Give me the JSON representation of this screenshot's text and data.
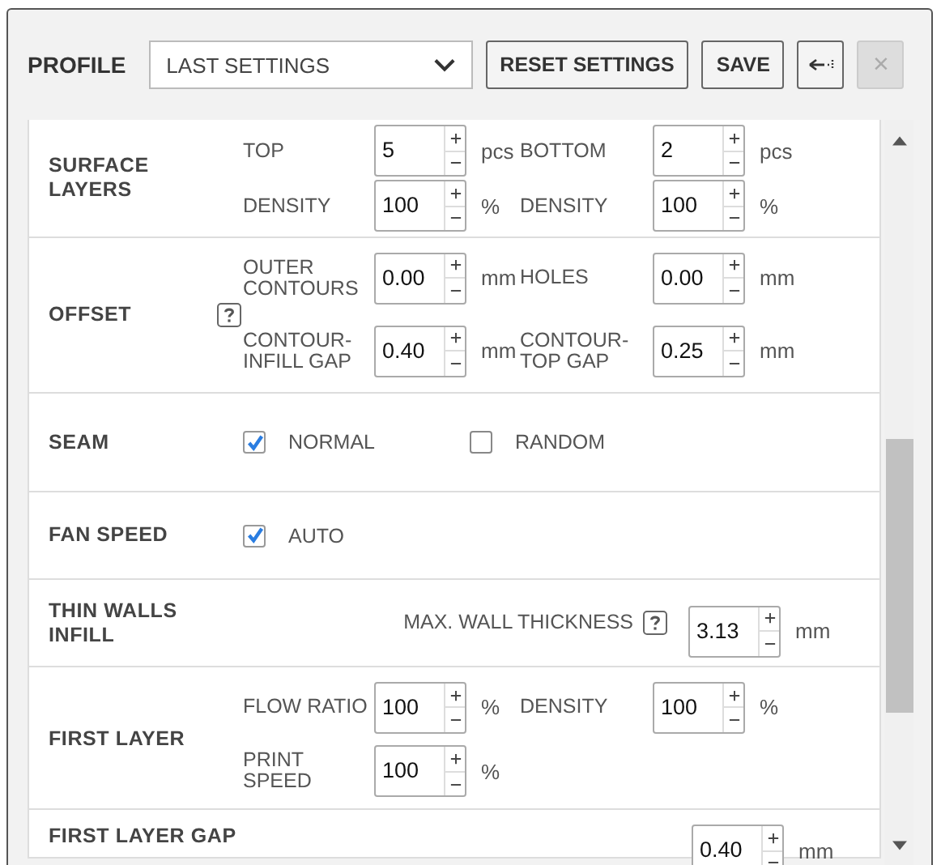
{
  "header": {
    "label": "PROFILE",
    "profile_select": {
      "value": "LAST SETTINGS"
    },
    "buttons": [
      {
        "kind": "text",
        "label": "RESET SETTINGS",
        "disabled": false
      },
      {
        "kind": "text",
        "label": "SAVE",
        "disabled": false
      },
      {
        "kind": "back_icon",
        "disabled": false
      },
      {
        "kind": "close",
        "label": "×",
        "disabled": true
      }
    ]
  },
  "sections": [
    {
      "kind": "fields",
      "title": "SURFACE LAYERS",
      "rows": [
        [
          {
            "label": "TOP",
            "value": "5",
            "unit": "pcs"
          },
          {
            "label": "BOTTOM",
            "value": "2",
            "unit": "pcs"
          }
        ],
        [
          {
            "label": "DENSITY",
            "value": "100",
            "unit": "%"
          },
          {
            "label": "DENSITY",
            "value": "100",
            "unit": "%"
          }
        ]
      ]
    },
    {
      "kind": "fields",
      "title": "OFFSET",
      "help": true,
      "rows": [
        [
          {
            "label": "OUTER CONTOURS",
            "value": "0.00",
            "unit": "mm"
          },
          {
            "label": "HOLES",
            "value": "0.00",
            "unit": "mm"
          }
        ],
        [
          {
            "label": "CONTOUR-INFILL GAP",
            "value": "0.40",
            "unit": "mm"
          },
          {
            "label": "CONTOUR-TOP GAP",
            "value": "0.25",
            "unit": "mm"
          }
        ]
      ]
    },
    {
      "kind": "checks",
      "title": "SEAM",
      "items": [
        {
          "label": "NORMAL",
          "checked": true
        },
        {
          "label": "RANDOM",
          "checked": false
        }
      ]
    },
    {
      "kind": "checks",
      "title": "FAN SPEED",
      "items": [
        {
          "label": "AUTO",
          "checked": true
        }
      ]
    },
    {
      "kind": "wide_field",
      "title": "THIN WALLS INFILL",
      "field": {
        "label": "MAX. WALL THICKNESS",
        "help": true,
        "value": "3.13",
        "unit": "mm"
      }
    },
    {
      "kind": "fields",
      "title": "FIRST LAYER",
      "rows": [
        [
          {
            "label": "FLOW RATIO",
            "value": "100",
            "unit": "%"
          },
          {
            "label": "DENSITY",
            "value": "100",
            "unit": "%"
          }
        ],
        [
          {
            "label": "PRINT SPEED",
            "value": "100",
            "unit": "%"
          }
        ]
      ]
    },
    {
      "kind": "wide_field",
      "title": "FIRST LAYER GAP",
      "field": {
        "value": "0.40",
        "unit": "mm"
      }
    }
  ]
}
